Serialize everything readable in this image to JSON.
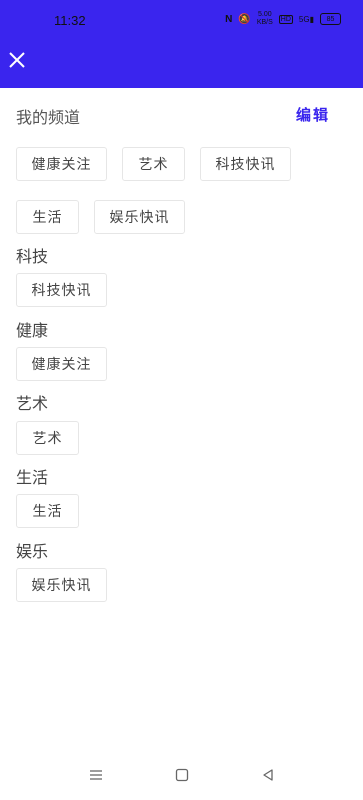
{
  "status_bar": {
    "time": "11:32",
    "net_speed_value": "5.00",
    "net_speed_unit": "KB/S",
    "hd_badge": "HD",
    "signal_label": "5G",
    "battery": "85"
  },
  "header": {
    "close_icon": "close-icon"
  },
  "my_channels": {
    "title": "我的频道",
    "edit_label": "编辑",
    "chips": [
      "健康关注",
      "艺术",
      "科技快讯",
      "生活",
      "娱乐快讯"
    ]
  },
  "categories": [
    {
      "title": "科技",
      "chips": [
        "科技快讯"
      ]
    },
    {
      "title": "健康",
      "chips": [
        "健康关注"
      ]
    },
    {
      "title": "艺术",
      "chips": [
        "艺术"
      ]
    },
    {
      "title": "生活",
      "chips": [
        "生活"
      ]
    },
    {
      "title": "娱乐",
      "chips": [
        "娱乐快讯"
      ]
    }
  ],
  "nav_bar": {
    "menu_icon": "menu-icon",
    "home_icon": "home-square-icon",
    "back_icon": "back-triangle-icon"
  },
  "colors": {
    "accent": "#3a25ee",
    "chip_border": "#e6e6e6",
    "text": "#444444"
  }
}
